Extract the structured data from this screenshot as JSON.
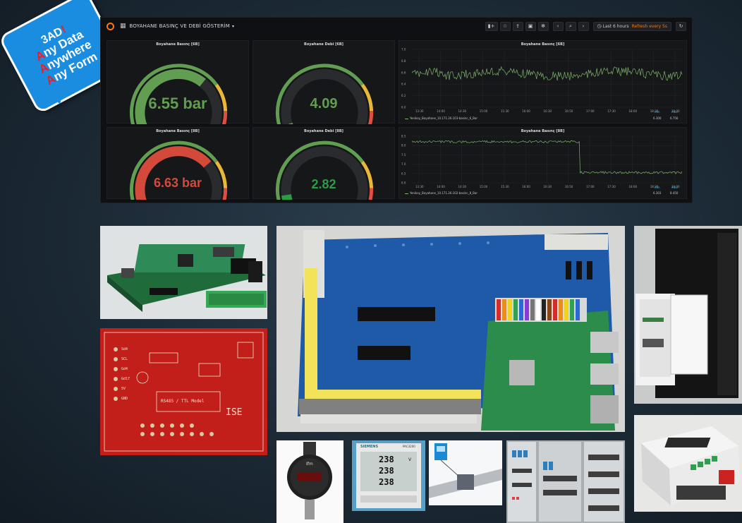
{
  "badge": {
    "line1": "3AD",
    "line1_mark": "!",
    "lines": [
      {
        "first": "A",
        "rest": "ny Data"
      },
      {
        "first": "A",
        "rest": "nywhere"
      },
      {
        "first": "A",
        "rest": "ny Form"
      }
    ]
  },
  "dashboard": {
    "title": "BOYAHANE BASINÇ VE DEBİ GÖSTERİM",
    "time_range": "Last 6 hours",
    "refresh": "Refresh every 5s",
    "gauges": [
      {
        "title": "Boyahane Basınç [6B]",
        "display": "6.55 bar",
        "fraction": 0.66,
        "color": "#629e51"
      },
      {
        "title": "Boyahane Debi [6B]",
        "display": "4.09",
        "fraction": 0.06,
        "color": "#629e51"
      },
      {
        "title": "Boyahane Basınç [8B]",
        "display": "6.63 bar",
        "fraction": 0.7,
        "color": "#d44a3a"
      },
      {
        "title": "Boyahane Debi [8B]",
        "display": "2.82",
        "fraction": 0.1,
        "color": "#299c46"
      }
    ],
    "graphs": [
      {
        "title": "Boyahane Basınç [6B]",
        "y_ticks": [
          "7.0",
          "6.8",
          "6.6",
          "6.4",
          "6.2",
          "6.0"
        ],
        "x_ticks": [
          "13:30",
          "14:00",
          "14:30",
          "15:00",
          "15:30",
          "16:00",
          "16:30",
          "16:50",
          "17:00",
          "17:30",
          "18:00",
          "18:30",
          "19:00"
        ],
        "legend_name": "Yenikoy_Boyahane_10.171.26.103-basinc_6_Bar",
        "stat_labels": [
          "min",
          "max"
        ],
        "stat_values": [
          "6.300",
          "6.756"
        ]
      },
      {
        "title": "Boyahane Basınç [8B]",
        "y_ticks": [
          "8.5",
          "8.0",
          "7.5",
          "7.0",
          "6.5",
          "6.0"
        ],
        "x_ticks": [
          "13:30",
          "14:00",
          "14:30",
          "15:00",
          "15:30",
          "16:00",
          "16:30",
          "16:50",
          "17:00",
          "17:30",
          "18:00",
          "18:30",
          "19:00"
        ],
        "legend_name": "Yenikoy_Boyahane_10.171.26.102-basinc_8_Bar",
        "stat_labels": [
          "min",
          "max"
        ],
        "stat_values": [
          "6.303",
          "8.450"
        ]
      }
    ]
  },
  "photos": {
    "pcb_red_texts": [
      "RS485 / TTL Model",
      "ISE",
      "Sd4",
      "SCL",
      "Gd4",
      "Gd17",
      "5V",
      "GND"
    ],
    "meter_values": [
      "238",
      "238",
      "238"
    ],
    "meter_unit": "V",
    "meter_brand": "SIEMENS",
    "meter_model": "PAC3200",
    "sensor_brand": "Ifm"
  },
  "colors": {
    "background": "#1c2a36",
    "grafana_bg": "#0f1013",
    "panel_bg": "#161719",
    "graph_line": "#7eb26d",
    "badge_blue": "#1a8de0",
    "badge_red": "#e8202a"
  }
}
